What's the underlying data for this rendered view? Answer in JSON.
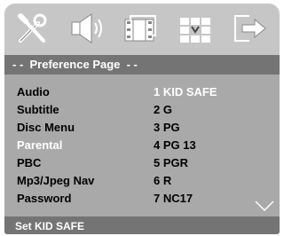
{
  "tabs": [
    {
      "icon": "tools-icon",
      "label": ""
    },
    {
      "icon": "speaker-icon",
      "label": ""
    },
    {
      "icon": "film-icon",
      "label": ""
    },
    {
      "icon": "grid-preference-icon",
      "label": ""
    },
    {
      "icon": "exit-icon",
      "label": ""
    }
  ],
  "title": "- -  Preference Page  - -",
  "settings": [
    "Audio",
    "Subtitle",
    "Disc Menu",
    "Parental",
    "PBC",
    "Mp3/Jpeg Nav",
    "Password"
  ],
  "active_setting": "Parental",
  "options": [
    "1 KID SAFE",
    "2 G",
    "3 PG",
    "4 PG 13",
    "5 PGR",
    "6 R",
    "7 NC17"
  ],
  "selected_option": "1 KID SAFE",
  "status": "Set KID SAFE",
  "colors": {
    "panel": "#c6c6c6",
    "bar": "#747474",
    "body": "#a9a9a9",
    "highlight": "#ffffff"
  }
}
